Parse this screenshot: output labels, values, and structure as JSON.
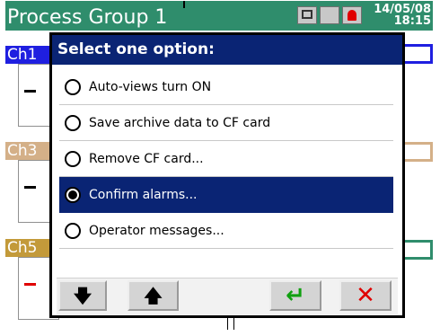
{
  "header": {
    "title": "Process Group 1",
    "date": "14/05/08",
    "time": "18:15",
    "icons": [
      "display-icon",
      "blank-icon",
      "alarm-bell-icon"
    ]
  },
  "channels": [
    {
      "label": "Ch1",
      "color": "#1f1fe0",
      "value": "—"
    },
    {
      "label": "Ch3",
      "color": "#d4b088",
      "value": "—"
    },
    {
      "label": "Ch5",
      "color": "#c39a3a",
      "value": "—"
    }
  ],
  "dialog": {
    "title": "Select one option:",
    "options": [
      {
        "label": "Auto-views turn ON",
        "selected": false
      },
      {
        "label": "Save archive data to CF card",
        "selected": false
      },
      {
        "label": "Remove CF card...",
        "selected": false
      },
      {
        "label": "Confirm alarms...",
        "selected": true
      },
      {
        "label": "Operator messages...",
        "selected": false
      }
    ],
    "buttons": {
      "down": "🡇",
      "up": "🡅",
      "enter": "↵",
      "cancel": "✕"
    }
  },
  "colors": {
    "header_bg": "#2f8d6c",
    "dialog_header_bg": "#0a2474",
    "selection_bg": "#0a2474",
    "enter_green": "#10a010",
    "cancel_red": "#e00000"
  }
}
